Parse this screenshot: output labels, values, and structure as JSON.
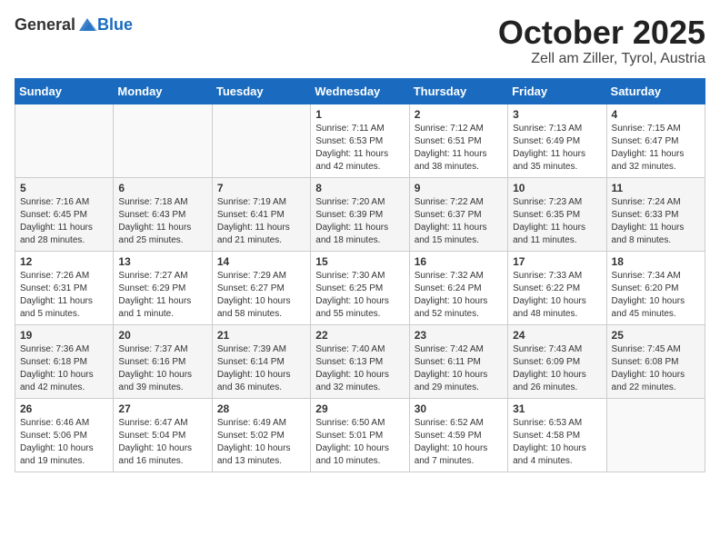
{
  "header": {
    "logo_general": "General",
    "logo_blue": "Blue",
    "month": "October 2025",
    "location": "Zell am Ziller, Tyrol, Austria"
  },
  "days_of_week": [
    "Sunday",
    "Monday",
    "Tuesday",
    "Wednesday",
    "Thursday",
    "Friday",
    "Saturday"
  ],
  "weeks": [
    [
      {
        "day": "",
        "info": ""
      },
      {
        "day": "",
        "info": ""
      },
      {
        "day": "",
        "info": ""
      },
      {
        "day": "1",
        "info": "Sunrise: 7:11 AM\nSunset: 6:53 PM\nDaylight: 11 hours and 42 minutes."
      },
      {
        "day": "2",
        "info": "Sunrise: 7:12 AM\nSunset: 6:51 PM\nDaylight: 11 hours and 38 minutes."
      },
      {
        "day": "3",
        "info": "Sunrise: 7:13 AM\nSunset: 6:49 PM\nDaylight: 11 hours and 35 minutes."
      },
      {
        "day": "4",
        "info": "Sunrise: 7:15 AM\nSunset: 6:47 PM\nDaylight: 11 hours and 32 minutes."
      }
    ],
    [
      {
        "day": "5",
        "info": "Sunrise: 7:16 AM\nSunset: 6:45 PM\nDaylight: 11 hours and 28 minutes."
      },
      {
        "day": "6",
        "info": "Sunrise: 7:18 AM\nSunset: 6:43 PM\nDaylight: 11 hours and 25 minutes."
      },
      {
        "day": "7",
        "info": "Sunrise: 7:19 AM\nSunset: 6:41 PM\nDaylight: 11 hours and 21 minutes."
      },
      {
        "day": "8",
        "info": "Sunrise: 7:20 AM\nSunset: 6:39 PM\nDaylight: 11 hours and 18 minutes."
      },
      {
        "day": "9",
        "info": "Sunrise: 7:22 AM\nSunset: 6:37 PM\nDaylight: 11 hours and 15 minutes."
      },
      {
        "day": "10",
        "info": "Sunrise: 7:23 AM\nSunset: 6:35 PM\nDaylight: 11 hours and 11 minutes."
      },
      {
        "day": "11",
        "info": "Sunrise: 7:24 AM\nSunset: 6:33 PM\nDaylight: 11 hours and 8 minutes."
      }
    ],
    [
      {
        "day": "12",
        "info": "Sunrise: 7:26 AM\nSunset: 6:31 PM\nDaylight: 11 hours and 5 minutes."
      },
      {
        "day": "13",
        "info": "Sunrise: 7:27 AM\nSunset: 6:29 PM\nDaylight: 11 hours and 1 minute."
      },
      {
        "day": "14",
        "info": "Sunrise: 7:29 AM\nSunset: 6:27 PM\nDaylight: 10 hours and 58 minutes."
      },
      {
        "day": "15",
        "info": "Sunrise: 7:30 AM\nSunset: 6:25 PM\nDaylight: 10 hours and 55 minutes."
      },
      {
        "day": "16",
        "info": "Sunrise: 7:32 AM\nSunset: 6:24 PM\nDaylight: 10 hours and 52 minutes."
      },
      {
        "day": "17",
        "info": "Sunrise: 7:33 AM\nSunset: 6:22 PM\nDaylight: 10 hours and 48 minutes."
      },
      {
        "day": "18",
        "info": "Sunrise: 7:34 AM\nSunset: 6:20 PM\nDaylight: 10 hours and 45 minutes."
      }
    ],
    [
      {
        "day": "19",
        "info": "Sunrise: 7:36 AM\nSunset: 6:18 PM\nDaylight: 10 hours and 42 minutes."
      },
      {
        "day": "20",
        "info": "Sunrise: 7:37 AM\nSunset: 6:16 PM\nDaylight: 10 hours and 39 minutes."
      },
      {
        "day": "21",
        "info": "Sunrise: 7:39 AM\nSunset: 6:14 PM\nDaylight: 10 hours and 36 minutes."
      },
      {
        "day": "22",
        "info": "Sunrise: 7:40 AM\nSunset: 6:13 PM\nDaylight: 10 hours and 32 minutes."
      },
      {
        "day": "23",
        "info": "Sunrise: 7:42 AM\nSunset: 6:11 PM\nDaylight: 10 hours and 29 minutes."
      },
      {
        "day": "24",
        "info": "Sunrise: 7:43 AM\nSunset: 6:09 PM\nDaylight: 10 hours and 26 minutes."
      },
      {
        "day": "25",
        "info": "Sunrise: 7:45 AM\nSunset: 6:08 PM\nDaylight: 10 hours and 22 minutes."
      }
    ],
    [
      {
        "day": "26",
        "info": "Sunrise: 6:46 AM\nSunset: 5:06 PM\nDaylight: 10 hours and 19 minutes."
      },
      {
        "day": "27",
        "info": "Sunrise: 6:47 AM\nSunset: 5:04 PM\nDaylight: 10 hours and 16 minutes."
      },
      {
        "day": "28",
        "info": "Sunrise: 6:49 AM\nSunset: 5:02 PM\nDaylight: 10 hours and 13 minutes."
      },
      {
        "day": "29",
        "info": "Sunrise: 6:50 AM\nSunset: 5:01 PM\nDaylight: 10 hours and 10 minutes."
      },
      {
        "day": "30",
        "info": "Sunrise: 6:52 AM\nSunset: 4:59 PM\nDaylight: 10 hours and 7 minutes."
      },
      {
        "day": "31",
        "info": "Sunrise: 6:53 AM\nSunset: 4:58 PM\nDaylight: 10 hours and 4 minutes."
      },
      {
        "day": "",
        "info": ""
      }
    ]
  ]
}
